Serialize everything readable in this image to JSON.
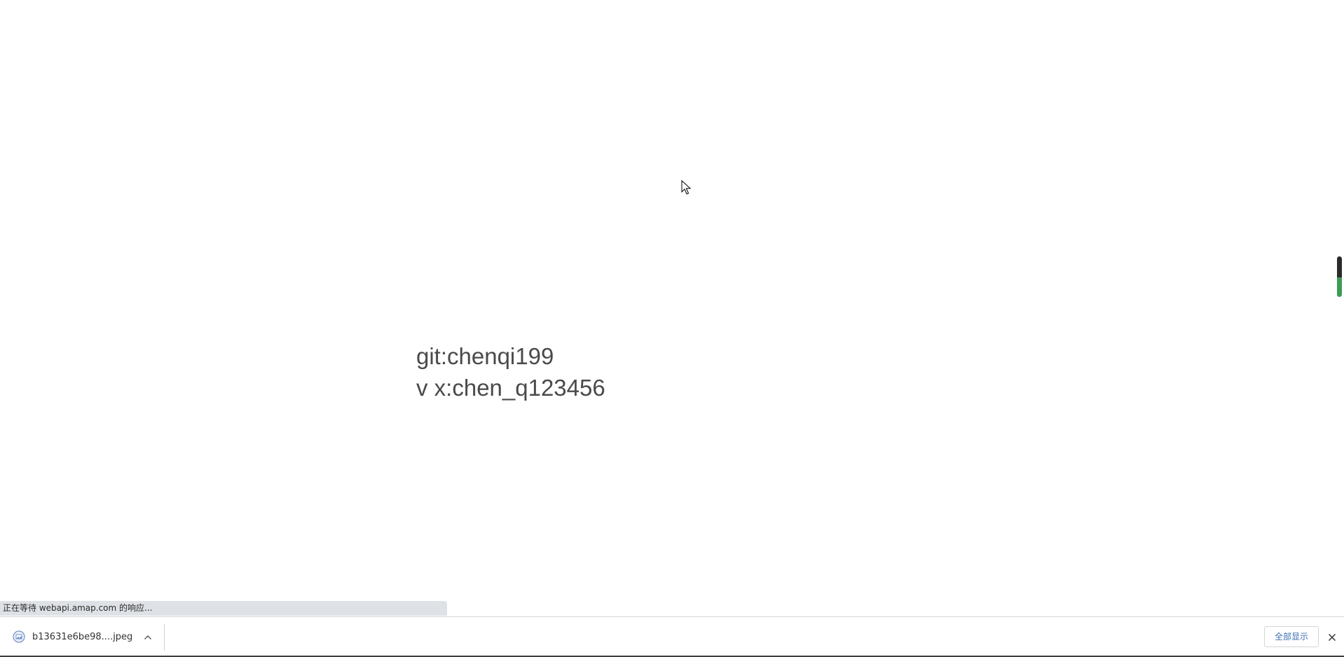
{
  "page": {
    "lines": [
      "git:chenqi199",
      "v x:chen_q123456"
    ],
    "text_color": "#4a4a4a"
  },
  "status_bar": {
    "text": "正在等待 webapi.amap.com 的响应..."
  },
  "download_shelf": {
    "item": {
      "file_name": "b13631e6be98....jpeg",
      "icon": "image-file-icon"
    },
    "show_all_label": "全部显示",
    "accent_color": "#3c6fb0"
  },
  "scrollbar": {
    "colors": [
      "#2b2b2b",
      "#3e9b57"
    ]
  }
}
